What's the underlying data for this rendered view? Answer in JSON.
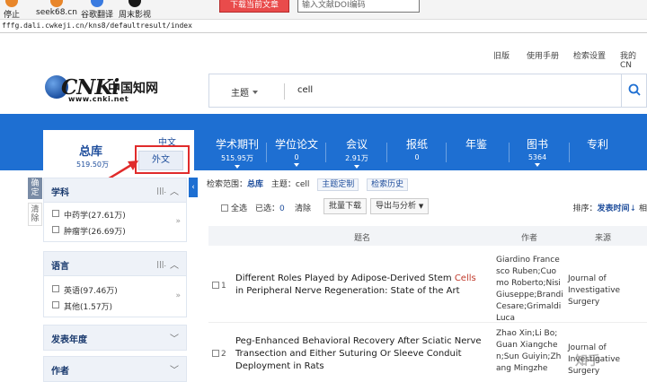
{
  "browser": {
    "shortcuts": [
      {
        "label": "停止",
        "color": "#e8862a"
      },
      {
        "label": "seek68.cn",
        "color": "#e8862a"
      },
      {
        "label": "谷歌翻译",
        "color": "#3a7be0"
      },
      {
        "label": "周末影视",
        "color": "#1a1a1a"
      }
    ],
    "red_button_label": "下载当前文章",
    "search_placeholder": "输入文献DOI编码",
    "url": "fffg.dali.cwkeji.cn/kns8/defaultresult/index"
  },
  "topnav": {
    "links": [
      "旧版",
      "使用手册",
      "检索设置",
      "我的CN"
    ]
  },
  "logo": {
    "main": "CNKi",
    "cn": "中国知网",
    "www": "www.cnki.net"
  },
  "search": {
    "scope": "主题",
    "query": "cell"
  },
  "categories": [
    {
      "label": "学术期刊",
      "count": "515.95万"
    },
    {
      "label": "学位论文",
      "count": "0"
    },
    {
      "label": "会议",
      "count": "2.91万"
    },
    {
      "label": "报纸",
      "count": "0"
    },
    {
      "label": "年鉴",
      "count": ""
    },
    {
      "label": "图书",
      "count": "5364"
    },
    {
      "label": "专利",
      "count": ""
    }
  ],
  "library": {
    "title": "总库",
    "count": "519.50万",
    "zh": "中文",
    "en": "外文"
  },
  "left_tabs": [
    "确定",
    "清除"
  ],
  "facets": {
    "subject": {
      "title": "学科",
      "items": [
        {
          "label": "中药学(27.61万)"
        },
        {
          "label": "肿瘤学(26.69万)"
        }
      ]
    },
    "language": {
      "title": "语言",
      "items": [
        {
          "label": "英语(97.46万)"
        },
        {
          "label": "其他(1.57万)"
        }
      ]
    },
    "year": {
      "title": "发表年度"
    },
    "author": {
      "title": "作者"
    }
  },
  "breadcrumb": {
    "prefix": "检索范围：",
    "scope": "总库",
    "topic": "主题：cell",
    "chip1": "主题定制",
    "chip2": "检索历史"
  },
  "toolbar": {
    "select_all": "全选",
    "selected": "已选：",
    "selected_count": "0",
    "clear": "清除",
    "batch_download": "批量下载",
    "export": "导出与分析",
    "sort_label": "排序：",
    "sort_value": "发表时间",
    "sort_more": "相"
  },
  "table": {
    "col_title": "题名",
    "col_author": "作者",
    "col_source": "来源"
  },
  "results": [
    {
      "num": "1",
      "title_pre": "Different Roles Played by Adipose-Derived Stem ",
      "title_hl": "Cells",
      "title_post": " in Peripheral Nerve Regeneration: State of the Art",
      "authors": "Giardino Francesco Ruben;Cuomo Roberto;Nisi Giuseppe;Brandi Cesare;Grimaldi Luca",
      "source": "Journal of Investigative Surgery"
    },
    {
      "num": "2",
      "title_pre": "Peg-Enhanced Behavioral Recovery After Sciatic Nerve Transection and Either Suturing Or Sleeve Conduit Deployment in Rats",
      "title_hl": "",
      "title_post": "",
      "authors": "Zhao Xin;Li Bo;Guan Xiangchen;Sun Guiyin;Zhang Mingzhe",
      "source": "Journal of Investigative Surgery"
    }
  ],
  "watermark": "知乎",
  "colors": {
    "brand_blue": "#1e6fd2",
    "annotation_red": "#e02b2b"
  }
}
